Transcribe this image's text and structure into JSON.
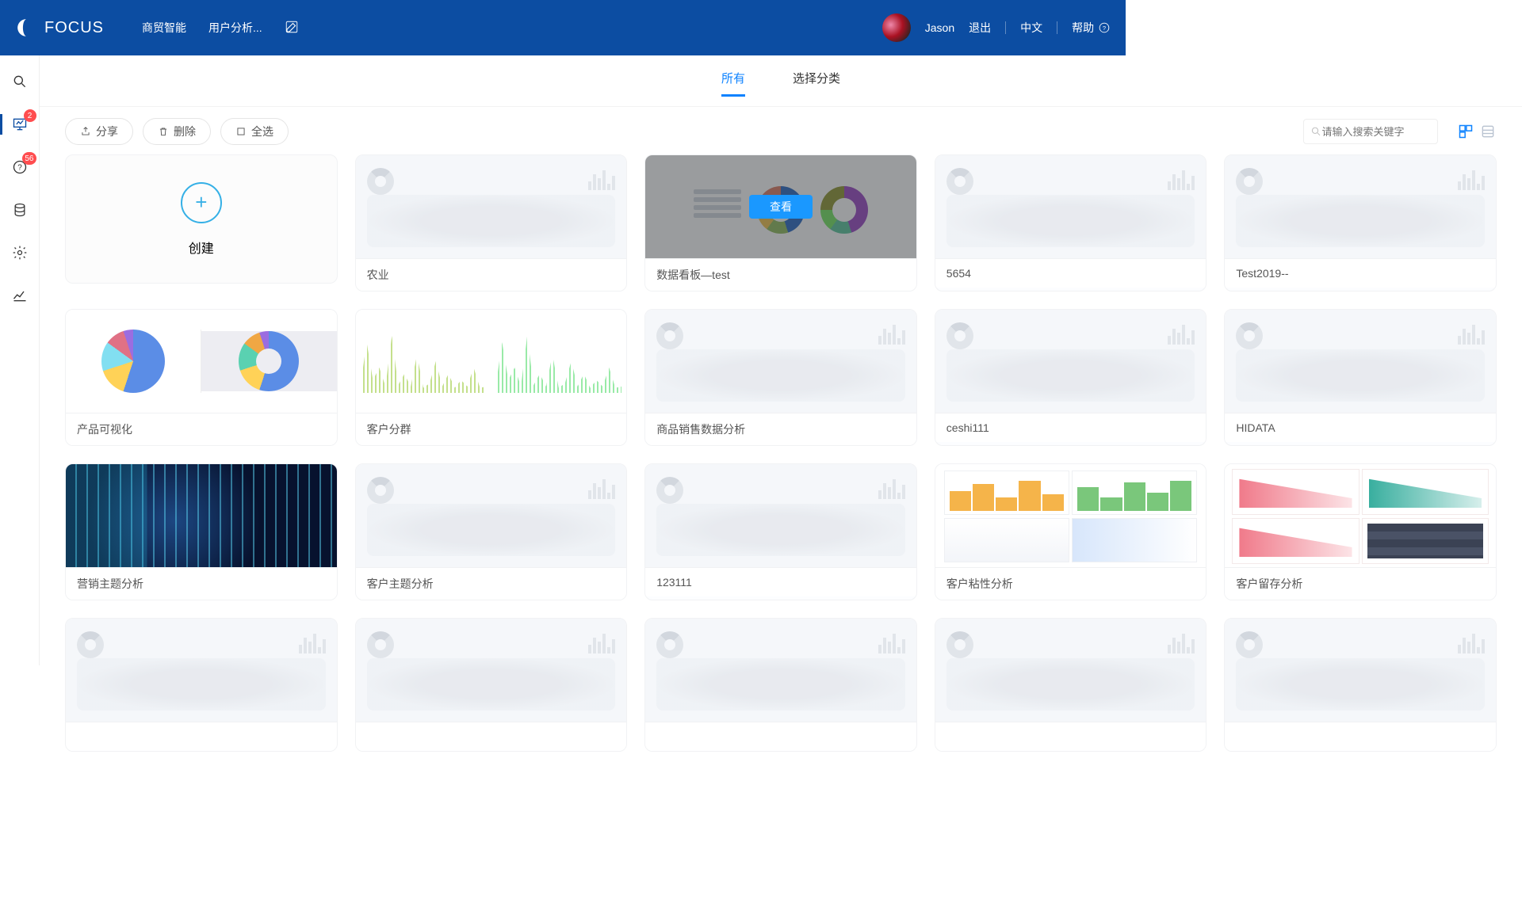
{
  "header": {
    "brand": "FOCUS",
    "nav": [
      "商贸智能",
      "用户分析..."
    ],
    "user": "Jason",
    "logout": "退出",
    "lang": "中文",
    "help": "帮助"
  },
  "sidebar": {
    "badges": {
      "dashboard": "2",
      "help": "56"
    }
  },
  "tabs": {
    "all": "所有",
    "category": "选择分类"
  },
  "toolbar": {
    "share": "分享",
    "delete": "删除",
    "selectAll": "全选",
    "searchPlaceholder": "请输入搜索关键字"
  },
  "createLabel": "创建",
  "hoverButton": "查看",
  "cards": [
    {
      "title": "农业",
      "thumb": "placeholder"
    },
    {
      "title": "数据看板—test",
      "thumb": "piedouble",
      "hover": true
    },
    {
      "title": "5654",
      "thumb": "placeholder"
    },
    {
      "title": "Test2019--",
      "thumb": "placeholder"
    },
    {
      "title": "产品可视化",
      "thumb": "pie2"
    },
    {
      "title": "客户分群",
      "thumb": "lines"
    },
    {
      "title": "商品销售数据分析",
      "thumb": "placeholder"
    },
    {
      "title": "ceshi111",
      "thumb": "placeholder"
    },
    {
      "title": "HIDATA",
      "thumb": "placeholder"
    },
    {
      "title": "营销主题分析",
      "thumb": "dark"
    },
    {
      "title": "客户主题分析",
      "thumb": "placeholder"
    },
    {
      "title": "123111",
      "thumb": "placeholder"
    },
    {
      "title": "客户粘性分析",
      "thumb": "multi"
    },
    {
      "title": "客户留存分析",
      "thumb": "retain"
    },
    {
      "title": "",
      "thumb": "placeholder"
    },
    {
      "title": "",
      "thumb": "placeholder"
    },
    {
      "title": "",
      "thumb": "placeholder"
    },
    {
      "title": "",
      "thumb": "placeholder"
    },
    {
      "title": "",
      "thumb": "placeholder"
    }
  ]
}
